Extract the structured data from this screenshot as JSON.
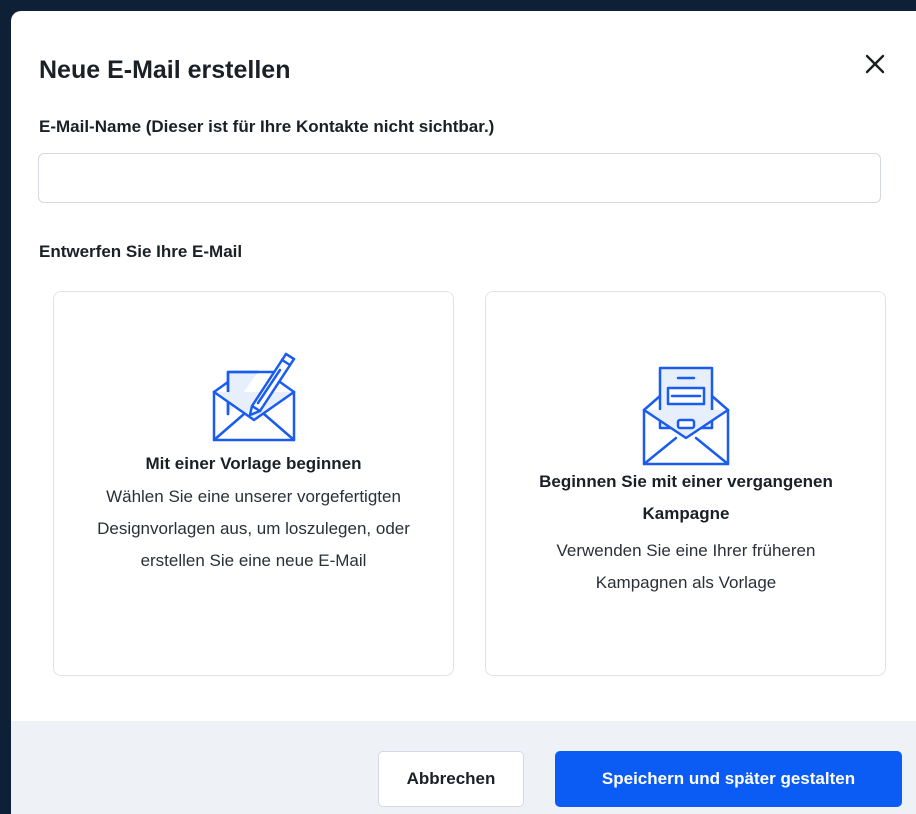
{
  "modal": {
    "title": "Neue E-Mail erstellen",
    "close_icon": "close-icon"
  },
  "email_name": {
    "label": "E-Mail-Name (Dieser ist für Ihre Kontakte nicht sichtbar.)",
    "value": "",
    "placeholder": ""
  },
  "design": {
    "label": "Entwerfen Sie Ihre E-Mail",
    "options": [
      {
        "icon": "envelope-pencil-icon",
        "title": "Mit einer Vorlage beginnen",
        "description": "Wählen Sie eine unserer vorgefertigten Designvorlagen aus, um loszulegen, oder erstellen Sie eine neue E-Mail"
      },
      {
        "icon": "envelope-letter-icon",
        "title": "Beginnen Sie mit einer vergangenen Kampagne",
        "description": "Verwenden Sie eine Ihrer früheren Kampagnen als Vorlage"
      }
    ]
  },
  "footer": {
    "cancel_label": "Abbrechen",
    "save_label": "Speichern und später gestalten"
  },
  "colors": {
    "accent": "#0b5cf5",
    "icon_stroke": "#1a5cf0",
    "icon_fill": "#e8effc",
    "footer_bg": "#eef1f6",
    "backdrop": "#0e2035"
  }
}
